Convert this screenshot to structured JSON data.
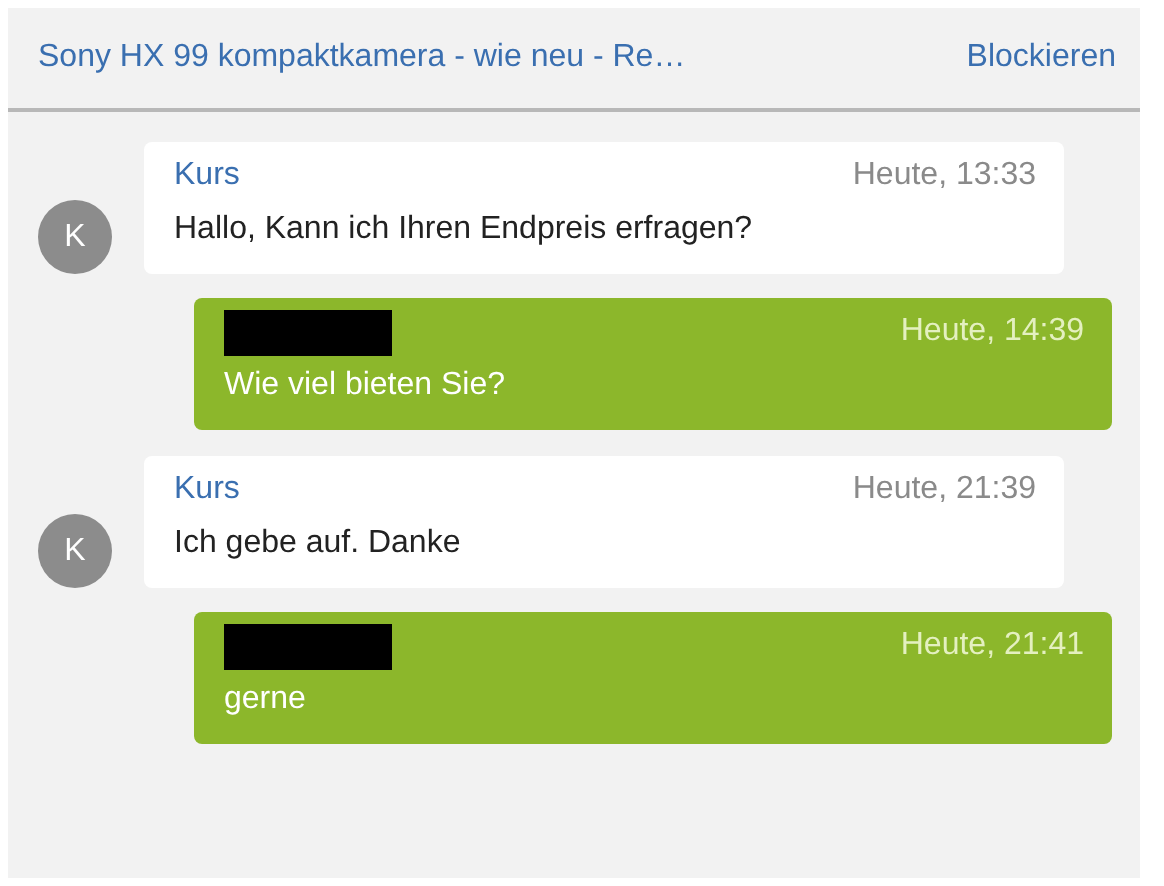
{
  "header": {
    "title": "Sony HX 99 kompaktkamera - wie neu - Re…",
    "action": "Blockieren"
  },
  "messages": [
    {
      "kind": "incoming",
      "avatar": "K",
      "sender": "Kurs",
      "time": "Heute, 13:33",
      "text": "Hallo, Kann ich Ihren Endpreis erfragen?"
    },
    {
      "kind": "outgoing",
      "sender_redacted": true,
      "time": "Heute, 14:39",
      "text": "Wie viel bieten Sie?"
    },
    {
      "kind": "incoming",
      "avatar": "K",
      "sender": "Kurs",
      "time": "Heute, 21:39",
      "text": "Ich gebe auf. Danke"
    },
    {
      "kind": "outgoing",
      "sender_redacted": true,
      "time": "Heute, 21:41",
      "text": "gerne"
    }
  ]
}
